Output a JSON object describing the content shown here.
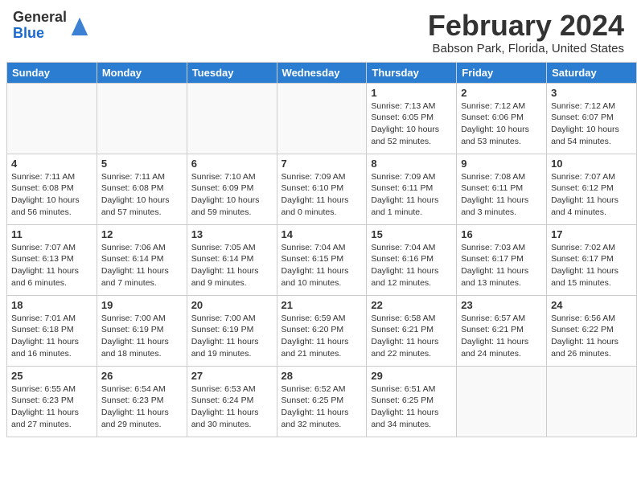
{
  "header": {
    "logo_general": "General",
    "logo_blue": "Blue",
    "month_title": "February 2024",
    "location": "Babson Park, Florida, United States"
  },
  "days_of_week": [
    "Sunday",
    "Monday",
    "Tuesday",
    "Wednesday",
    "Thursday",
    "Friday",
    "Saturday"
  ],
  "weeks": [
    [
      {
        "day": "",
        "empty": true
      },
      {
        "day": "",
        "empty": true
      },
      {
        "day": "",
        "empty": true
      },
      {
        "day": "",
        "empty": true
      },
      {
        "day": "1",
        "detail": "Sunrise: 7:13 AM\nSunset: 6:05 PM\nDaylight: 10 hours\nand 52 minutes."
      },
      {
        "day": "2",
        "detail": "Sunrise: 7:12 AM\nSunset: 6:06 PM\nDaylight: 10 hours\nand 53 minutes."
      },
      {
        "day": "3",
        "detail": "Sunrise: 7:12 AM\nSunset: 6:07 PM\nDaylight: 10 hours\nand 54 minutes."
      }
    ],
    [
      {
        "day": "4",
        "detail": "Sunrise: 7:11 AM\nSunset: 6:08 PM\nDaylight: 10 hours\nand 56 minutes."
      },
      {
        "day": "5",
        "detail": "Sunrise: 7:11 AM\nSunset: 6:08 PM\nDaylight: 10 hours\nand 57 minutes."
      },
      {
        "day": "6",
        "detail": "Sunrise: 7:10 AM\nSunset: 6:09 PM\nDaylight: 10 hours\nand 59 minutes."
      },
      {
        "day": "7",
        "detail": "Sunrise: 7:09 AM\nSunset: 6:10 PM\nDaylight: 11 hours\nand 0 minutes."
      },
      {
        "day": "8",
        "detail": "Sunrise: 7:09 AM\nSunset: 6:11 PM\nDaylight: 11 hours\nand 1 minute."
      },
      {
        "day": "9",
        "detail": "Sunrise: 7:08 AM\nSunset: 6:11 PM\nDaylight: 11 hours\nand 3 minutes."
      },
      {
        "day": "10",
        "detail": "Sunrise: 7:07 AM\nSunset: 6:12 PM\nDaylight: 11 hours\nand 4 minutes."
      }
    ],
    [
      {
        "day": "11",
        "detail": "Sunrise: 7:07 AM\nSunset: 6:13 PM\nDaylight: 11 hours\nand 6 minutes."
      },
      {
        "day": "12",
        "detail": "Sunrise: 7:06 AM\nSunset: 6:14 PM\nDaylight: 11 hours\nand 7 minutes."
      },
      {
        "day": "13",
        "detail": "Sunrise: 7:05 AM\nSunset: 6:14 PM\nDaylight: 11 hours\nand 9 minutes."
      },
      {
        "day": "14",
        "detail": "Sunrise: 7:04 AM\nSunset: 6:15 PM\nDaylight: 11 hours\nand 10 minutes."
      },
      {
        "day": "15",
        "detail": "Sunrise: 7:04 AM\nSunset: 6:16 PM\nDaylight: 11 hours\nand 12 minutes."
      },
      {
        "day": "16",
        "detail": "Sunrise: 7:03 AM\nSunset: 6:17 PM\nDaylight: 11 hours\nand 13 minutes."
      },
      {
        "day": "17",
        "detail": "Sunrise: 7:02 AM\nSunset: 6:17 PM\nDaylight: 11 hours\nand 15 minutes."
      }
    ],
    [
      {
        "day": "18",
        "detail": "Sunrise: 7:01 AM\nSunset: 6:18 PM\nDaylight: 11 hours\nand 16 minutes."
      },
      {
        "day": "19",
        "detail": "Sunrise: 7:00 AM\nSunset: 6:19 PM\nDaylight: 11 hours\nand 18 minutes."
      },
      {
        "day": "20",
        "detail": "Sunrise: 7:00 AM\nSunset: 6:19 PM\nDaylight: 11 hours\nand 19 minutes."
      },
      {
        "day": "21",
        "detail": "Sunrise: 6:59 AM\nSunset: 6:20 PM\nDaylight: 11 hours\nand 21 minutes."
      },
      {
        "day": "22",
        "detail": "Sunrise: 6:58 AM\nSunset: 6:21 PM\nDaylight: 11 hours\nand 22 minutes."
      },
      {
        "day": "23",
        "detail": "Sunrise: 6:57 AM\nSunset: 6:21 PM\nDaylight: 11 hours\nand 24 minutes."
      },
      {
        "day": "24",
        "detail": "Sunrise: 6:56 AM\nSunset: 6:22 PM\nDaylight: 11 hours\nand 26 minutes."
      }
    ],
    [
      {
        "day": "25",
        "detail": "Sunrise: 6:55 AM\nSunset: 6:23 PM\nDaylight: 11 hours\nand 27 minutes."
      },
      {
        "day": "26",
        "detail": "Sunrise: 6:54 AM\nSunset: 6:23 PM\nDaylight: 11 hours\nand 29 minutes."
      },
      {
        "day": "27",
        "detail": "Sunrise: 6:53 AM\nSunset: 6:24 PM\nDaylight: 11 hours\nand 30 minutes."
      },
      {
        "day": "28",
        "detail": "Sunrise: 6:52 AM\nSunset: 6:25 PM\nDaylight: 11 hours\nand 32 minutes."
      },
      {
        "day": "29",
        "detail": "Sunrise: 6:51 AM\nSunset: 6:25 PM\nDaylight: 11 hours\nand 34 minutes."
      },
      {
        "day": "",
        "empty": true
      },
      {
        "day": "",
        "empty": true
      }
    ]
  ]
}
